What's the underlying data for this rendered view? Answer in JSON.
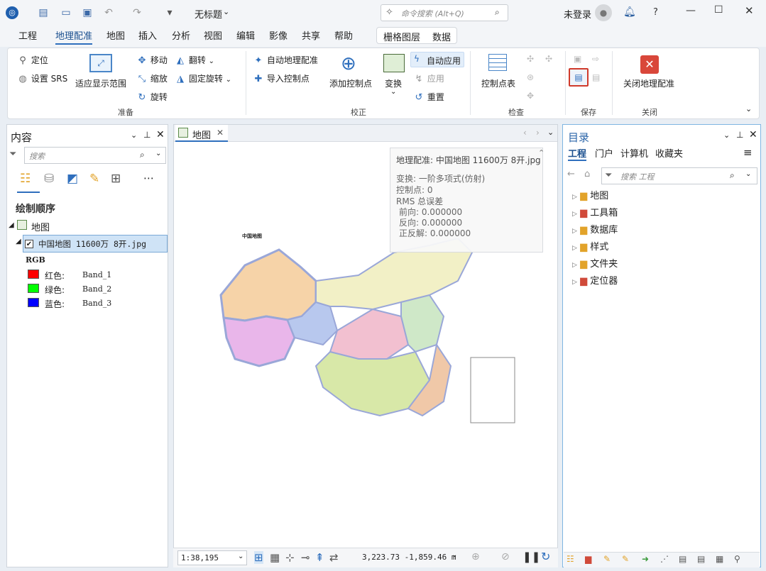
{
  "title_bar": {
    "app_icon": "arcgis-pro-icon",
    "project_title": "无标题",
    "user": "未登录",
    "help": "?",
    "search_placeholder": "命令搜索 (Alt+Q)"
  },
  "menu": {
    "tabs": [
      "工程",
      "地理配准",
      "地图",
      "插入",
      "分析",
      "视图",
      "编辑",
      "影像",
      "共享",
      "帮助"
    ],
    "active": "地理配准",
    "contextual": [
      "栅格图层",
      "数据"
    ]
  },
  "ribbon": {
    "prepare": {
      "locate": "定位",
      "set_srs": "设置 SRS",
      "fit_display": "适应显示范围",
      "move": "移动",
      "scale": "缩放",
      "rotate": "旋转",
      "flip": "翻转",
      "fixed_rotate": "固定旋转",
      "group": "准备"
    },
    "adjust": {
      "auto_georef": "自动地理配准",
      "import_cp": "导入控制点",
      "add_cp": "添加控制点",
      "transform": "变换",
      "auto_apply": "自动应用",
      "apply": "应用",
      "reset": "重置",
      "group": "校正"
    },
    "review": {
      "cp_table": "控制点表",
      "group": "检查"
    },
    "save": {
      "group": "保存"
    },
    "close": {
      "close_georef": "关闭地理配准",
      "group": "关闭"
    }
  },
  "contents": {
    "title": "内容",
    "search_placeholder": "搜索",
    "draw_order": "绘制顺序",
    "map_name": "地图",
    "layer_name": "中国地图 11600万 8开.jpg",
    "rgb": "RGB",
    "bands": [
      {
        "label": "红色:",
        "band": "Band_1",
        "color": "#ff0000"
      },
      {
        "label": "绿色:",
        "band": "Band_2",
        "color": "#00ff00"
      },
      {
        "label": "蓝色:",
        "band": "Band_3",
        "color": "#0000ff"
      }
    ]
  },
  "map_view": {
    "tab": "地图",
    "info_title": "地理配准: 中国地图 11600万 8开.jpg",
    "transform": "变换:   一阶多项式(仿射)",
    "cp_count": "控制点:   0",
    "rms": "RMS 总误差",
    "forward": "前向:   0.000000",
    "reverse": "反向:   0.000000",
    "fwd_rev": "正反解:   0.000000",
    "map_title": "中国地图",
    "scale": "1:38,195",
    "coords": "3,223.73 -1,859.46 m"
  },
  "catalog": {
    "title": "目录",
    "tabs": [
      "工程",
      "门户",
      "计算机",
      "收藏夹"
    ],
    "search_placeholder": "搜索 工程",
    "items": [
      "地图",
      "工具箱",
      "数据库",
      "样式",
      "文件夹",
      "定位器"
    ]
  }
}
